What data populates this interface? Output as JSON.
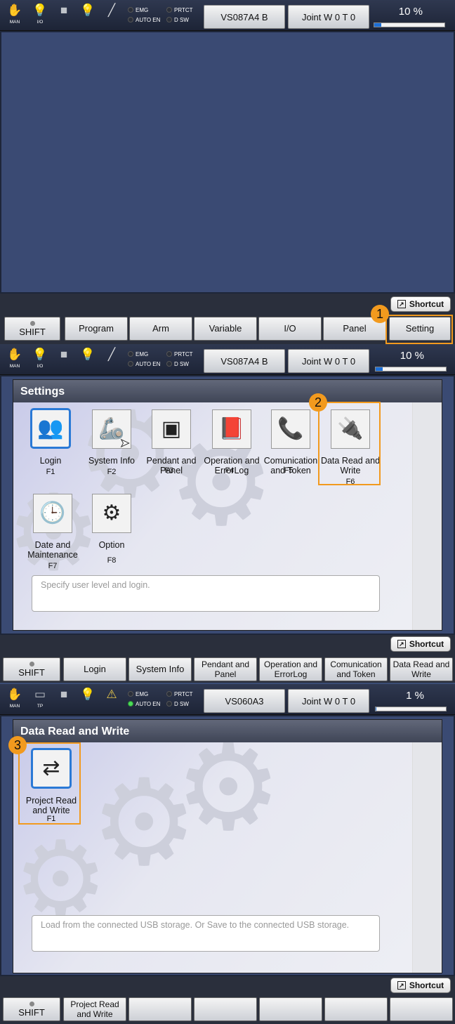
{
  "screens": [
    {
      "status": {
        "mode_label": "MAN",
        "io_label": "I/O",
        "emg": "EMG",
        "prtct": "PRTCT",
        "auto_en": "AUTO EN",
        "dsw": "D SW",
        "robot": "VS087A4 B",
        "coord": "Joint W 0 T 0",
        "speed": "10 %",
        "speed_value": 10
      },
      "shortcut": "Shortcut",
      "keys": [
        "SHIFT",
        "Program",
        "Arm",
        "Variable",
        "I/O",
        "Panel",
        "Setting"
      ],
      "marker": "1"
    },
    {
      "status": {
        "mode_label": "MAN",
        "io_label": "I/O",
        "emg": "EMG",
        "prtct": "PRTCT",
        "auto_en": "AUTO EN",
        "dsw": "D SW",
        "robot": "VS087A4 B",
        "coord": "Joint W 0 T 0",
        "speed": "10 %",
        "speed_value": 10
      },
      "title": "Settings",
      "tiles": [
        {
          "label": "Login",
          "key": "F1",
          "icon": "user-login-icon"
        },
        {
          "label": "System Info",
          "key": "F2",
          "icon": "robot-arm-icon"
        },
        {
          "label": "Pendant and Panel",
          "key": "F3",
          "icon": "pendant-icon"
        },
        {
          "label": "Operation and ErrorLog",
          "key": "F4",
          "icon": "log-book-icon"
        },
        {
          "label": "Comunication and Token",
          "key": "F5",
          "icon": "phone-icon"
        },
        {
          "label": "Data Read and Write",
          "key": "F6",
          "icon": "usb-icon"
        },
        {
          "label": "Date and Maintenance",
          "key": "F7",
          "icon": "clock-calendar-icon"
        },
        {
          "label": "Option",
          "key": "F8",
          "icon": "gears-icon"
        }
      ],
      "description": "Specify user level and login.",
      "shortcut": "Shortcut",
      "keys": [
        "SHIFT",
        "Login",
        "System Info",
        "Pendant and Panel",
        "Operation and ErrorLog",
        "Comunication and Token",
        "Data Read and Write"
      ],
      "marker": "2"
    },
    {
      "status": {
        "mode_label": "MAN",
        "io_label": "TP",
        "emg": "EMG",
        "prtct": "PRTCT",
        "auto_en": "AUTO EN",
        "dsw": "D SW",
        "robot": "VS060A3",
        "coord": "Joint W 0 T 0",
        "speed": "1 %",
        "speed_value": 1
      },
      "title": "Data Read and Write",
      "tiles": [
        {
          "label": "Project Read and Write",
          "key": "F1",
          "icon": "usb-transfer-icon"
        }
      ],
      "description": "Load from the connected USB storage. Or Save to the connected USB storage.",
      "shortcut": "Shortcut",
      "keys": [
        "SHIFT",
        "Project Read and Write",
        "",
        "",
        "",
        "",
        ""
      ],
      "marker": "3"
    }
  ],
  "colors": {
    "highlight": "#f29a1e",
    "selected": "#2a79d6",
    "panel": "#3a4a73"
  }
}
